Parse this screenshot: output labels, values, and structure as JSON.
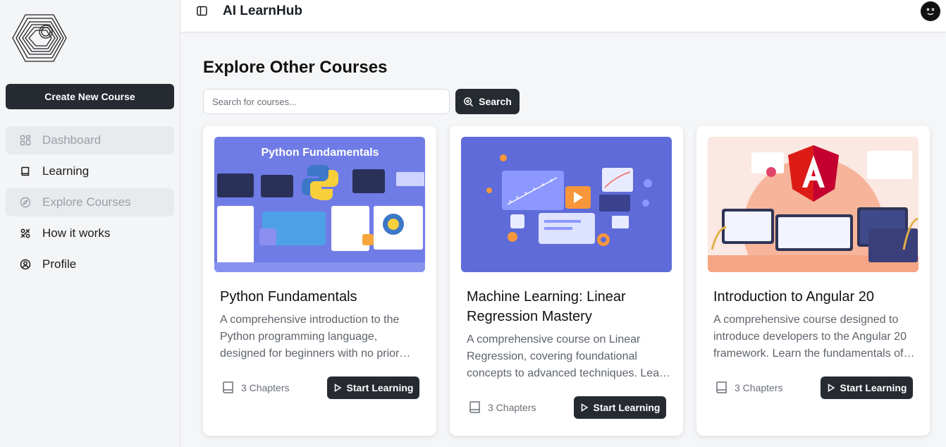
{
  "app": {
    "title": "AI LearnHub"
  },
  "sidebar": {
    "create_label": "Create New Course",
    "items": [
      {
        "label": "Dashboard",
        "icon": "grid-icon"
      },
      {
        "label": "Learning",
        "icon": "book-icon"
      },
      {
        "label": "Explore Courses",
        "icon": "compass-icon"
      },
      {
        "label": "How it works",
        "icon": "tools-icon"
      },
      {
        "label": "Profile",
        "icon": "user-circle-icon"
      }
    ]
  },
  "main": {
    "page_title": "Explore Other Courses",
    "search": {
      "placeholder": "Search for courses...",
      "button_label": "Search"
    },
    "courses": [
      {
        "title": "Python Fundamentals",
        "description": "A comprehensive introduction to the Python programming language, designed for beginners with no prior experience.",
        "chapters": "3 Chapters",
        "button_label": "Start Learning",
        "thumb_heading": "Python Fundamentals"
      },
      {
        "title": "Machine Learning: Linear Regression Mastery",
        "description": "A comprehensive course on Linear Regression, covering foundational concepts to advanced techniques. Learn to build models.",
        "chapters": "3 Chapters",
        "button_label": "Start Learning"
      },
      {
        "title": "Introduction to Angular 20",
        "description": "A comprehensive course designed to introduce developers to the Angular 20 framework. Learn the fundamentals of components.",
        "chapters": "3 Chapters",
        "button_label": "Start Learning"
      }
    ]
  },
  "colors": {
    "primary": "#262a31",
    "muted_bg": "#e9eaed",
    "thumb_python": "#6f7ce6",
    "thumb_ml": "#5e6bd8",
    "thumb_angular": "#fbe4dc"
  }
}
